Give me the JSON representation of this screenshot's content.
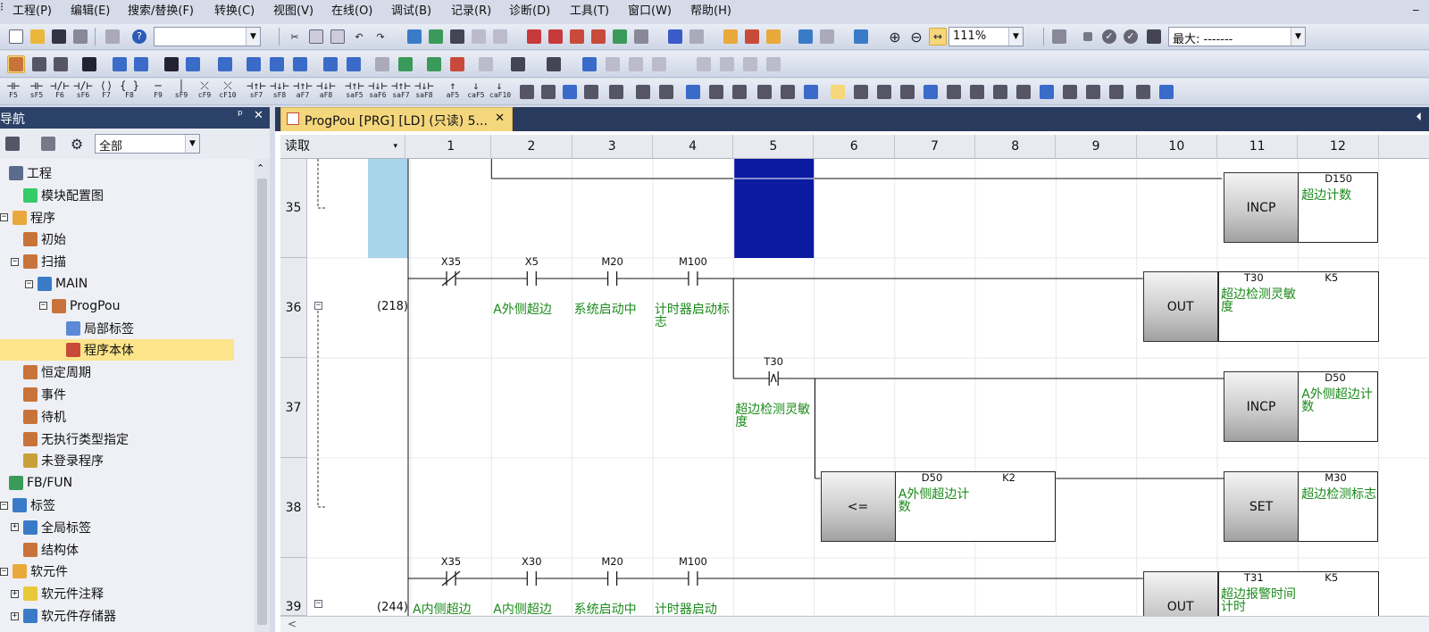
{
  "menu": [
    "工程(P)",
    "编辑(E)",
    "搜索/替换(F)",
    "转换(C)",
    "视图(V)",
    "在线(O)",
    "调试(B)",
    "记录(R)",
    "诊断(D)",
    "工具(T)",
    "窗口(W)",
    "帮助(H)"
  ],
  "window_minimize": "_",
  "toolbar": {
    "zoom": "111%",
    "max_label": "最大: -------",
    "fkeys": [
      {
        "sym": "⊣⊢",
        "label": "F5"
      },
      {
        "sym": "⊣⊢",
        "label": "sF5"
      },
      {
        "sym": "⊣/⊢",
        "label": "F6"
      },
      {
        "sym": "⊣/⊢",
        "label": "sF6"
      },
      {
        "sym": "⟨⟩",
        "label": "F7"
      },
      {
        "sym": "{ }",
        "label": "F8"
      },
      {
        "sym": "─",
        "label": "F9"
      },
      {
        "sym": "│",
        "label": "sF9"
      },
      {
        "sym": "⤫",
        "label": "cF9"
      },
      {
        "sym": "⤫",
        "label": "cF10"
      },
      {
        "sym": "⊣↑⊢",
        "label": "sF7"
      },
      {
        "sym": "⊣↓⊢",
        "label": "sF8"
      },
      {
        "sym": "⊣↑⊢",
        "label": "aF7"
      },
      {
        "sym": "⊣↓⊢",
        "label": "aF8"
      },
      {
        "sym": "⊣↑⊢",
        "label": "saF5"
      },
      {
        "sym": "⊣↓⊢",
        "label": "saF6"
      },
      {
        "sym": "⊣↑⊢",
        "label": "saF7"
      },
      {
        "sym": "⊣↓⊢",
        "label": "saF8"
      },
      {
        "sym": "↑",
        "label": "aF5"
      },
      {
        "sym": "↓",
        "label": "caF5"
      },
      {
        "sym": "↓",
        "label": "caF10"
      }
    ]
  },
  "nav": {
    "title": "导航",
    "pin": "ᵖ",
    "close": "✕",
    "filter": "全部",
    "tree": [
      {
        "label": "工程",
        "level": 0,
        "exp": "",
        "color": "#5a6b8c"
      },
      {
        "label": "模块配置图",
        "level": 1,
        "exp": "",
        "color": "#3c6"
      },
      {
        "label": "程序",
        "level": 0,
        "exp": "−",
        "color": "#e9a93a"
      },
      {
        "label": "初始",
        "level": 1,
        "exp": "",
        "color": "#c8733a"
      },
      {
        "label": "扫描",
        "level": 1,
        "exp": "−",
        "color": "#c8733a"
      },
      {
        "label": "MAIN",
        "level": 2,
        "exp": "−",
        "color": "#3a7bc8"
      },
      {
        "label": "ProgPou",
        "level": 3,
        "exp": "−",
        "color": "#c8733a"
      },
      {
        "label": "局部标签",
        "level": 4,
        "exp": "",
        "color": "#5a8ad8"
      },
      {
        "label": "程序本体",
        "level": 4,
        "exp": "",
        "color": "#c84a3a",
        "selected": true
      },
      {
        "label": "恒定周期",
        "level": 1,
        "exp": "",
        "color": "#c8733a"
      },
      {
        "label": "事件",
        "level": 1,
        "exp": "",
        "color": "#c8733a"
      },
      {
        "label": "待机",
        "level": 1,
        "exp": "",
        "color": "#c8733a"
      },
      {
        "label": "无执行类型指定",
        "level": 1,
        "exp": "",
        "color": "#c8733a"
      },
      {
        "label": "未登录程序",
        "level": 1,
        "exp": "",
        "color": "#c8a03a"
      },
      {
        "label": "FB/FUN",
        "level": 0,
        "exp": "",
        "color": "#3a9a5a"
      },
      {
        "label": "标签",
        "level": 0,
        "exp": "−",
        "color": "#3a7bc8"
      },
      {
        "label": "全局标签",
        "level": 1,
        "exp": "+",
        "color": "#3a7bc8"
      },
      {
        "label": "结构体",
        "level": 1,
        "exp": "",
        "color": "#c8733a"
      },
      {
        "label": "软元件",
        "level": 0,
        "exp": "−",
        "color": "#e9a93a"
      },
      {
        "label": "软元件注释",
        "level": 1,
        "exp": "+",
        "color": "#e9c93a"
      },
      {
        "label": "软元件存储器",
        "level": 1,
        "exp": "+",
        "color": "#3a7bc8"
      }
    ]
  },
  "editor": {
    "tab_title": "ProgPou [PRG] [LD] (只读) 5...",
    "tab_close": "✕",
    "mode": "读取",
    "columns": [
      "1",
      "2",
      "3",
      "4",
      "5",
      "6",
      "7",
      "8",
      "9",
      "10",
      "11",
      "12"
    ],
    "rows": [
      {
        "no": "35",
        "step": ""
      },
      {
        "no": "36",
        "step": "(218)"
      },
      {
        "no": "37",
        "step": ""
      },
      {
        "no": "38",
        "step": ""
      },
      {
        "no": "39",
        "step": "(244)"
      }
    ],
    "r35": {
      "inst": "INCP",
      "operand": "D150",
      "comment": "超边计数"
    },
    "r36": {
      "contacts": [
        {
          "dev": "X35",
          "type": "nc",
          "comment": ""
        },
        {
          "dev": "X5",
          "type": "no",
          "comment": "A外侧超边"
        },
        {
          "dev": "M20",
          "type": "no",
          "comment": "系统启动中"
        },
        {
          "dev": "M100",
          "type": "no",
          "comment": "计时器启动标志"
        }
      ],
      "inst": "OUT",
      "operand": "T30",
      "comment": "超边检测灵敏度",
      "k": "K5"
    },
    "r37": {
      "contact": "T30",
      "contact_comment": "超边检测灵敏度",
      "inst": "INCP",
      "operand": "D50",
      "comment": "A外侧超边计数"
    },
    "r38": {
      "cmp": "<=",
      "op1": "D50",
      "op1_comment": "A外侧超边计数",
      "op2": "K2",
      "inst": "SET",
      "operand": "M30",
      "comment": "超边检测标志"
    },
    "r39": {
      "contacts": [
        {
          "dev": "X35",
          "comment": "A内侧超边"
        },
        {
          "dev": "X30",
          "comment": "A内侧超边"
        },
        {
          "dev": "M20",
          "comment": "系统启动中"
        },
        {
          "dev": "M100",
          "comment": "计时器启动"
        }
      ],
      "inst": "OUT",
      "operand": "T31",
      "comment": "超边报警时间计时",
      "k": "K5"
    },
    "scroll_left": "<"
  }
}
